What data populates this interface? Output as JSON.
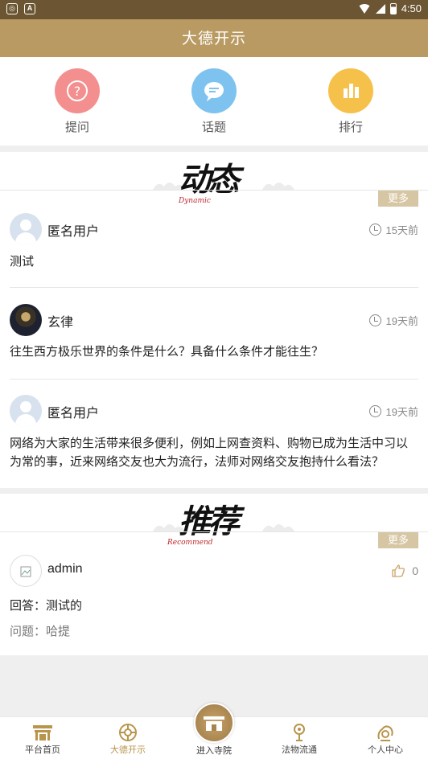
{
  "status_bar": {
    "time": "4:50"
  },
  "header": {
    "title": "大德开示"
  },
  "quick_actions": [
    {
      "label": "提问",
      "icon": "question-icon",
      "color": "#f48f8f"
    },
    {
      "label": "话题",
      "icon": "chat-bubble-icon",
      "color": "#7ec3ef"
    },
    {
      "label": "排行",
      "icon": "bar-chart-icon",
      "color": "#f6c14a"
    }
  ],
  "dynamic": {
    "title": "动态",
    "subtitle": "Dynamic",
    "more_label": "更多",
    "posts": [
      {
        "user": "匿名用户",
        "time": "15天前",
        "content": "测试"
      },
      {
        "user": "玄律",
        "time": "19天前",
        "content": "往生西方极乐世界的条件是什么？具备什么条件才能往生？"
      },
      {
        "user": "匿名用户",
        "time": "19天前",
        "content": "网络为大家的生活带来很多便利，例如上网查资料、购物已成为生活中习以为常的事，近来网络交友也大为流行，法师对网络交友抱持什么看法？"
      }
    ]
  },
  "recommend": {
    "title": "推荐",
    "subtitle": "Recommend",
    "more_label": "更多",
    "items": [
      {
        "user": "admin",
        "likes": "0",
        "answer": "回答：测试的",
        "question": "问题：哈提"
      }
    ]
  },
  "bottom_nav": {
    "items": [
      {
        "label": "平台首页",
        "icon": "temple-gate-icon"
      },
      {
        "label": "大德开示",
        "icon": "dharma-wheel-icon"
      },
      {
        "label": "进入寺院",
        "icon": "temple-icon"
      },
      {
        "label": "法物流通",
        "icon": "prayer-beads-icon"
      },
      {
        "label": "个人中心",
        "icon": "person-cloud-icon"
      }
    ],
    "active_color": "#b9954c"
  }
}
